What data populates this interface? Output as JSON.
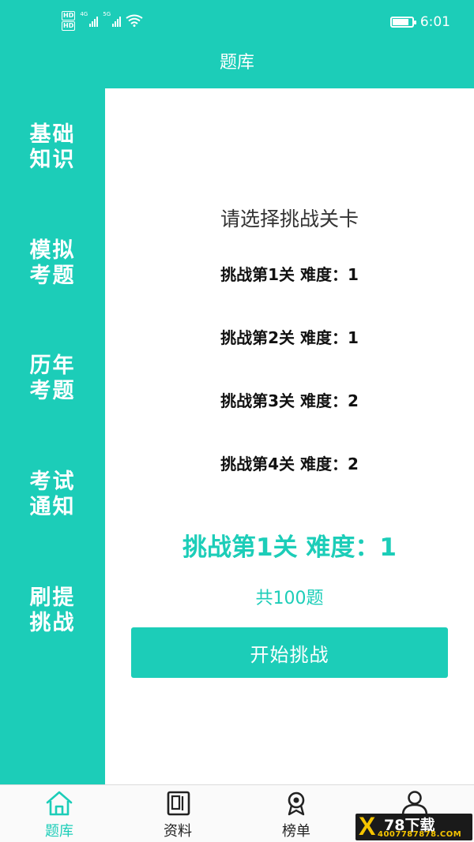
{
  "status_bar": {
    "hd_badges": [
      "HD",
      "HD"
    ],
    "signal1_label": "4G",
    "signal2_label": "5G",
    "time": "6:01",
    "battery_level": 0.85
  },
  "header": {
    "title": "题库"
  },
  "sidebar": {
    "items": [
      {
        "line1": "基础",
        "line2": "知识"
      },
      {
        "line1": "模拟",
        "line2": "考题"
      },
      {
        "line1": "历年",
        "line2": "考题"
      },
      {
        "line1": "考试",
        "line2": "通知"
      },
      {
        "line1": "刷提",
        "line2": "挑战"
      }
    ]
  },
  "main": {
    "prompt": "请选择挑战关卡",
    "levels": [
      {
        "label": "挑战第1关 难度：1"
      },
      {
        "label": "挑战第2关 难度：1"
      },
      {
        "label": "挑战第3关 难度：2"
      },
      {
        "label": "挑战第4关 难度：2"
      }
    ],
    "selected": "挑战第1关 难度：1",
    "question_count": "共100题",
    "start_button": "开始挑战"
  },
  "bottom_nav": {
    "items": [
      {
        "label": "题库",
        "icon": "home-icon",
        "active": true
      },
      {
        "label": "资料",
        "icon": "document-icon",
        "active": false
      },
      {
        "label": "榜单",
        "icon": "medal-icon",
        "active": false
      },
      {
        "label": "",
        "icon": "person-icon",
        "active": false
      }
    ]
  },
  "watermark": {
    "brand": "78下载",
    "url": "4007787878.COM"
  },
  "colors": {
    "accent": "#1ccdb8",
    "text": "#111111"
  }
}
